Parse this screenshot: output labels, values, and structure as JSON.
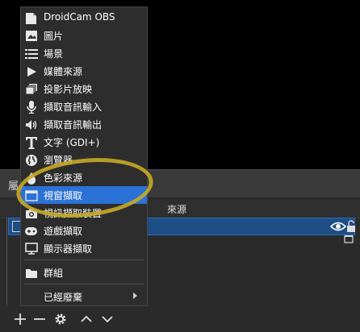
{
  "menu": {
    "items": [
      {
        "label": "DroidCam OBS",
        "icon": "droidcam-icon"
      },
      {
        "label": "圖片",
        "icon": "image-icon"
      },
      {
        "label": "場景",
        "icon": "scene-list-icon"
      },
      {
        "label": "媒體來源",
        "icon": "play-icon"
      },
      {
        "label": "投影片放映",
        "icon": "slideshow-icon"
      },
      {
        "label": "擷取音訊輸入",
        "icon": "microphone-icon"
      },
      {
        "label": "擷取音訊輸出",
        "icon": "speaker-icon"
      },
      {
        "label": "文字 (GDI+)",
        "icon": "text-icon"
      },
      {
        "label": "瀏覽器",
        "icon": "globe-icon"
      },
      {
        "label": "色彩來源",
        "icon": "color-icon"
      },
      {
        "label": "視窗擷取",
        "icon": "window-icon",
        "highlighted": true
      },
      {
        "label": "視訊擷取裝置",
        "icon": "camera-icon"
      },
      {
        "label": "遊戲擷取",
        "icon": "gamepad-icon"
      },
      {
        "label": "顯示器擷取",
        "icon": "monitor-icon"
      }
    ],
    "group": {
      "label": "群組",
      "icon": "folder-icon"
    },
    "deprecated": {
      "label": "已經廢棄"
    }
  },
  "dock": {
    "title_fragment": "屬",
    "sources_header": "來源"
  },
  "colors": {
    "menu_bg": "#2d2d2d",
    "highlight": "#2b72d6",
    "selected_row": "#1d4e85",
    "annotation": "#c6aa28"
  }
}
